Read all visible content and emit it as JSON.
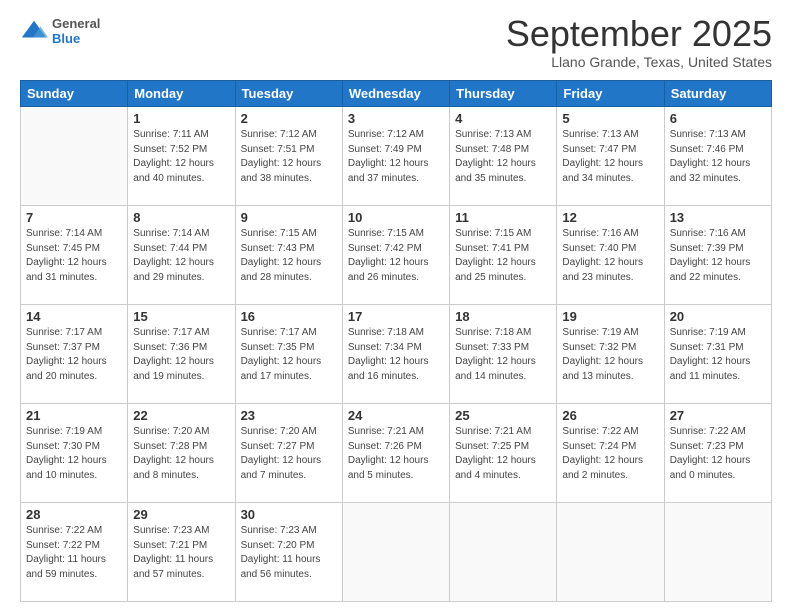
{
  "header": {
    "logo": {
      "general": "General",
      "blue": "Blue"
    },
    "title": "September 2025",
    "location": "Llano Grande, Texas, United States"
  },
  "calendar": {
    "days_of_week": [
      "Sunday",
      "Monday",
      "Tuesday",
      "Wednesday",
      "Thursday",
      "Friday",
      "Saturday"
    ],
    "weeks": [
      [
        {
          "day": "",
          "info": ""
        },
        {
          "day": "1",
          "info": "Sunrise: 7:11 AM\nSunset: 7:52 PM\nDaylight: 12 hours\nand 40 minutes."
        },
        {
          "day": "2",
          "info": "Sunrise: 7:12 AM\nSunset: 7:51 PM\nDaylight: 12 hours\nand 38 minutes."
        },
        {
          "day": "3",
          "info": "Sunrise: 7:12 AM\nSunset: 7:49 PM\nDaylight: 12 hours\nand 37 minutes."
        },
        {
          "day": "4",
          "info": "Sunrise: 7:13 AM\nSunset: 7:48 PM\nDaylight: 12 hours\nand 35 minutes."
        },
        {
          "day": "5",
          "info": "Sunrise: 7:13 AM\nSunset: 7:47 PM\nDaylight: 12 hours\nand 34 minutes."
        },
        {
          "day": "6",
          "info": "Sunrise: 7:13 AM\nSunset: 7:46 PM\nDaylight: 12 hours\nand 32 minutes."
        }
      ],
      [
        {
          "day": "7",
          "info": "Sunrise: 7:14 AM\nSunset: 7:45 PM\nDaylight: 12 hours\nand 31 minutes."
        },
        {
          "day": "8",
          "info": "Sunrise: 7:14 AM\nSunset: 7:44 PM\nDaylight: 12 hours\nand 29 minutes."
        },
        {
          "day": "9",
          "info": "Sunrise: 7:15 AM\nSunset: 7:43 PM\nDaylight: 12 hours\nand 28 minutes."
        },
        {
          "day": "10",
          "info": "Sunrise: 7:15 AM\nSunset: 7:42 PM\nDaylight: 12 hours\nand 26 minutes."
        },
        {
          "day": "11",
          "info": "Sunrise: 7:15 AM\nSunset: 7:41 PM\nDaylight: 12 hours\nand 25 minutes."
        },
        {
          "day": "12",
          "info": "Sunrise: 7:16 AM\nSunset: 7:40 PM\nDaylight: 12 hours\nand 23 minutes."
        },
        {
          "day": "13",
          "info": "Sunrise: 7:16 AM\nSunset: 7:39 PM\nDaylight: 12 hours\nand 22 minutes."
        }
      ],
      [
        {
          "day": "14",
          "info": "Sunrise: 7:17 AM\nSunset: 7:37 PM\nDaylight: 12 hours\nand 20 minutes."
        },
        {
          "day": "15",
          "info": "Sunrise: 7:17 AM\nSunset: 7:36 PM\nDaylight: 12 hours\nand 19 minutes."
        },
        {
          "day": "16",
          "info": "Sunrise: 7:17 AM\nSunset: 7:35 PM\nDaylight: 12 hours\nand 17 minutes."
        },
        {
          "day": "17",
          "info": "Sunrise: 7:18 AM\nSunset: 7:34 PM\nDaylight: 12 hours\nand 16 minutes."
        },
        {
          "day": "18",
          "info": "Sunrise: 7:18 AM\nSunset: 7:33 PM\nDaylight: 12 hours\nand 14 minutes."
        },
        {
          "day": "19",
          "info": "Sunrise: 7:19 AM\nSunset: 7:32 PM\nDaylight: 12 hours\nand 13 minutes."
        },
        {
          "day": "20",
          "info": "Sunrise: 7:19 AM\nSunset: 7:31 PM\nDaylight: 12 hours\nand 11 minutes."
        }
      ],
      [
        {
          "day": "21",
          "info": "Sunrise: 7:19 AM\nSunset: 7:30 PM\nDaylight: 12 hours\nand 10 minutes."
        },
        {
          "day": "22",
          "info": "Sunrise: 7:20 AM\nSunset: 7:28 PM\nDaylight: 12 hours\nand 8 minutes."
        },
        {
          "day": "23",
          "info": "Sunrise: 7:20 AM\nSunset: 7:27 PM\nDaylight: 12 hours\nand 7 minutes."
        },
        {
          "day": "24",
          "info": "Sunrise: 7:21 AM\nSunset: 7:26 PM\nDaylight: 12 hours\nand 5 minutes."
        },
        {
          "day": "25",
          "info": "Sunrise: 7:21 AM\nSunset: 7:25 PM\nDaylight: 12 hours\nand 4 minutes."
        },
        {
          "day": "26",
          "info": "Sunrise: 7:22 AM\nSunset: 7:24 PM\nDaylight: 12 hours\nand 2 minutes."
        },
        {
          "day": "27",
          "info": "Sunrise: 7:22 AM\nSunset: 7:23 PM\nDaylight: 12 hours\nand 0 minutes."
        }
      ],
      [
        {
          "day": "28",
          "info": "Sunrise: 7:22 AM\nSunset: 7:22 PM\nDaylight: 11 hours\nand 59 minutes."
        },
        {
          "day": "29",
          "info": "Sunrise: 7:23 AM\nSunset: 7:21 PM\nDaylight: 11 hours\nand 57 minutes."
        },
        {
          "day": "30",
          "info": "Sunrise: 7:23 AM\nSunset: 7:20 PM\nDaylight: 11 hours\nand 56 minutes."
        },
        {
          "day": "",
          "info": ""
        },
        {
          "day": "",
          "info": ""
        },
        {
          "day": "",
          "info": ""
        },
        {
          "day": "",
          "info": ""
        }
      ]
    ]
  }
}
